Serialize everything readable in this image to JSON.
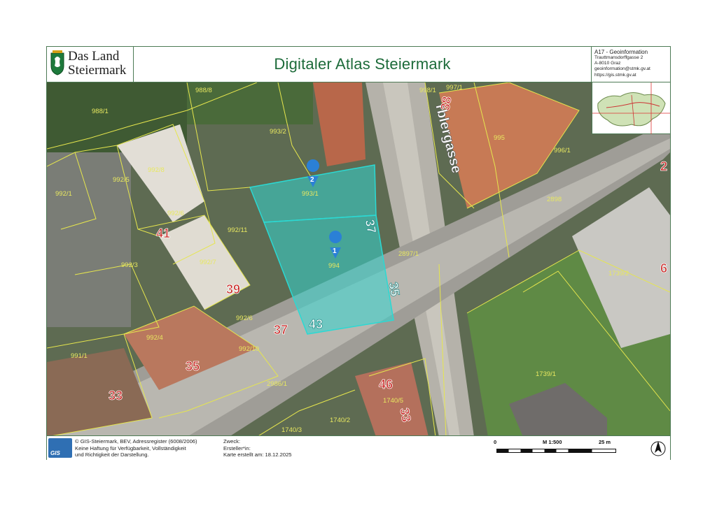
{
  "header": {
    "logo_line1": "Das Land",
    "logo_line2": "Steiermark",
    "title": "Digitaler Atlas Steiermark",
    "info": {
      "department": "A17 - Geoinformation",
      "street": "Trauttmansdorffgasse 2",
      "city": "A-8010 Graz",
      "email": "geoinformation@stmk.gv.at",
      "web": "https://gis.stmk.gv.at"
    }
  },
  "map": {
    "street_name": "rblergasse",
    "parcels": [
      "988/8",
      "988/1",
      "993/2",
      "992/8",
      "992/5",
      "992/1",
      "993/1",
      "998/1",
      "997/1",
      "995",
      "996/1",
      "2898",
      "992/6",
      "992/11",
      "992/3",
      "992/7",
      "994",
      "2897/1",
      "1739/2",
      "992/6",
      "992/4",
      "992/10",
      "991/1",
      "2986/1",
      "1739/1",
      "1740/5",
      "1740/3",
      "1740/2"
    ],
    "house_numbers": [
      "38",
      "41",
      "39",
      "37",
      "43",
      "35",
      "37",
      "35",
      "33",
      "46",
      "33",
      "2",
      "6"
    ],
    "markers": [
      {
        "id": "2",
        "color": "#2b80d6"
      },
      {
        "id": "1",
        "color": "#2b80d6"
      }
    ],
    "highlight_color": "#33d6d0",
    "parcel_line_color": "#e6e64d",
    "house_number_color": "#c8201e"
  },
  "footer": {
    "copyright_line1": "© GIS-Steiermark, BEV, Adressregister (6008/2006)",
    "copyright_line2": "Keine Haftung für Verfügbarkeit, Vollständigkeit",
    "copyright_line3": "und Richtigkeit der Darstellung.",
    "purpose_label": "Zweck:",
    "creator_label": "Ersteller*in:",
    "created_label": "Karte erstellt am: 18.12.2025",
    "scale_start": "0",
    "scale_ratio": "M 1:500",
    "scale_end": "25 m",
    "gis_logo_text": "GIS"
  }
}
